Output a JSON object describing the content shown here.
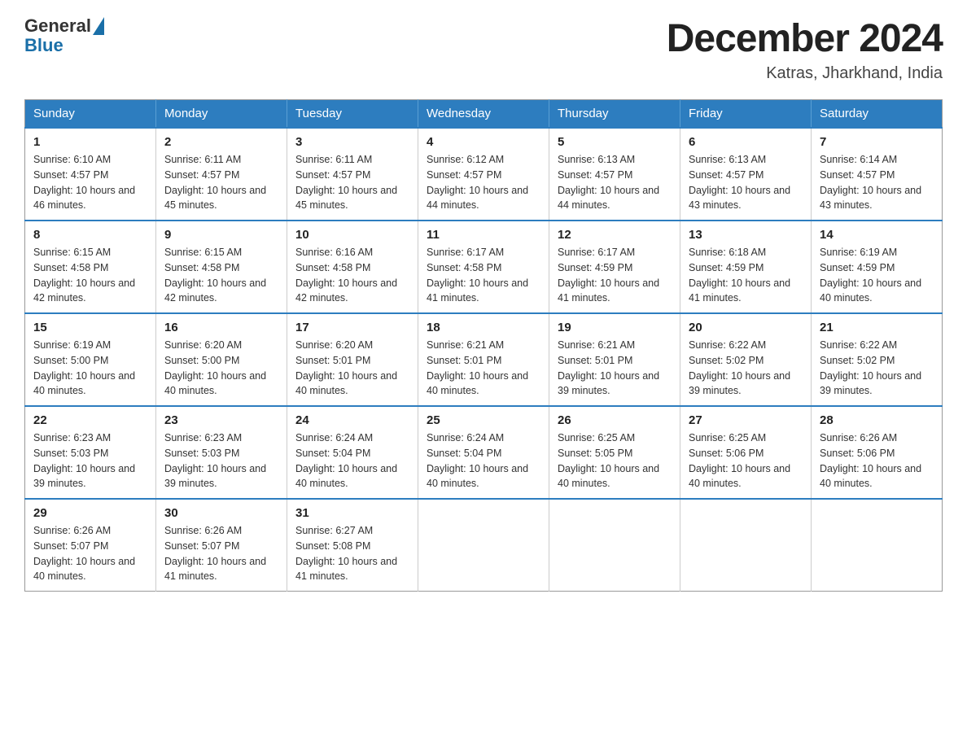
{
  "logo": {
    "text_general": "General",
    "text_blue": "Blue"
  },
  "header": {
    "month_title": "December 2024",
    "subtitle": "Katras, Jharkhand, India"
  },
  "days_of_week": [
    "Sunday",
    "Monday",
    "Tuesday",
    "Wednesday",
    "Thursday",
    "Friday",
    "Saturday"
  ],
  "weeks": [
    [
      {
        "day": "1",
        "sunrise": "6:10 AM",
        "sunset": "4:57 PM",
        "daylight": "10 hours and 46 minutes."
      },
      {
        "day": "2",
        "sunrise": "6:11 AM",
        "sunset": "4:57 PM",
        "daylight": "10 hours and 45 minutes."
      },
      {
        "day": "3",
        "sunrise": "6:11 AM",
        "sunset": "4:57 PM",
        "daylight": "10 hours and 45 minutes."
      },
      {
        "day": "4",
        "sunrise": "6:12 AM",
        "sunset": "4:57 PM",
        "daylight": "10 hours and 44 minutes."
      },
      {
        "day": "5",
        "sunrise": "6:13 AM",
        "sunset": "4:57 PM",
        "daylight": "10 hours and 44 minutes."
      },
      {
        "day": "6",
        "sunrise": "6:13 AM",
        "sunset": "4:57 PM",
        "daylight": "10 hours and 43 minutes."
      },
      {
        "day": "7",
        "sunrise": "6:14 AM",
        "sunset": "4:57 PM",
        "daylight": "10 hours and 43 minutes."
      }
    ],
    [
      {
        "day": "8",
        "sunrise": "6:15 AM",
        "sunset": "4:58 PM",
        "daylight": "10 hours and 42 minutes."
      },
      {
        "day": "9",
        "sunrise": "6:15 AM",
        "sunset": "4:58 PM",
        "daylight": "10 hours and 42 minutes."
      },
      {
        "day": "10",
        "sunrise": "6:16 AM",
        "sunset": "4:58 PM",
        "daylight": "10 hours and 42 minutes."
      },
      {
        "day": "11",
        "sunrise": "6:17 AM",
        "sunset": "4:58 PM",
        "daylight": "10 hours and 41 minutes."
      },
      {
        "day": "12",
        "sunrise": "6:17 AM",
        "sunset": "4:59 PM",
        "daylight": "10 hours and 41 minutes."
      },
      {
        "day": "13",
        "sunrise": "6:18 AM",
        "sunset": "4:59 PM",
        "daylight": "10 hours and 41 minutes."
      },
      {
        "day": "14",
        "sunrise": "6:19 AM",
        "sunset": "4:59 PM",
        "daylight": "10 hours and 40 minutes."
      }
    ],
    [
      {
        "day": "15",
        "sunrise": "6:19 AM",
        "sunset": "5:00 PM",
        "daylight": "10 hours and 40 minutes."
      },
      {
        "day": "16",
        "sunrise": "6:20 AM",
        "sunset": "5:00 PM",
        "daylight": "10 hours and 40 minutes."
      },
      {
        "day": "17",
        "sunrise": "6:20 AM",
        "sunset": "5:01 PM",
        "daylight": "10 hours and 40 minutes."
      },
      {
        "day": "18",
        "sunrise": "6:21 AM",
        "sunset": "5:01 PM",
        "daylight": "10 hours and 40 minutes."
      },
      {
        "day": "19",
        "sunrise": "6:21 AM",
        "sunset": "5:01 PM",
        "daylight": "10 hours and 39 minutes."
      },
      {
        "day": "20",
        "sunrise": "6:22 AM",
        "sunset": "5:02 PM",
        "daylight": "10 hours and 39 minutes."
      },
      {
        "day": "21",
        "sunrise": "6:22 AM",
        "sunset": "5:02 PM",
        "daylight": "10 hours and 39 minutes."
      }
    ],
    [
      {
        "day": "22",
        "sunrise": "6:23 AM",
        "sunset": "5:03 PM",
        "daylight": "10 hours and 39 minutes."
      },
      {
        "day": "23",
        "sunrise": "6:23 AM",
        "sunset": "5:03 PM",
        "daylight": "10 hours and 39 minutes."
      },
      {
        "day": "24",
        "sunrise": "6:24 AM",
        "sunset": "5:04 PM",
        "daylight": "10 hours and 40 minutes."
      },
      {
        "day": "25",
        "sunrise": "6:24 AM",
        "sunset": "5:04 PM",
        "daylight": "10 hours and 40 minutes."
      },
      {
        "day": "26",
        "sunrise": "6:25 AM",
        "sunset": "5:05 PM",
        "daylight": "10 hours and 40 minutes."
      },
      {
        "day": "27",
        "sunrise": "6:25 AM",
        "sunset": "5:06 PM",
        "daylight": "10 hours and 40 minutes."
      },
      {
        "day": "28",
        "sunrise": "6:26 AM",
        "sunset": "5:06 PM",
        "daylight": "10 hours and 40 minutes."
      }
    ],
    [
      {
        "day": "29",
        "sunrise": "6:26 AM",
        "sunset": "5:07 PM",
        "daylight": "10 hours and 40 minutes."
      },
      {
        "day": "30",
        "sunrise": "6:26 AM",
        "sunset": "5:07 PM",
        "daylight": "10 hours and 41 minutes."
      },
      {
        "day": "31",
        "sunrise": "6:27 AM",
        "sunset": "5:08 PM",
        "daylight": "10 hours and 41 minutes."
      },
      null,
      null,
      null,
      null
    ]
  ]
}
